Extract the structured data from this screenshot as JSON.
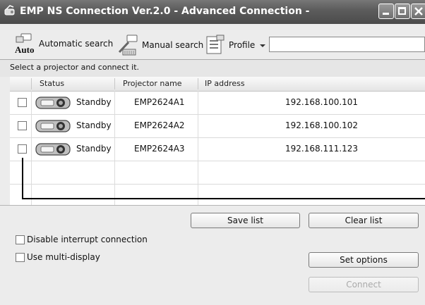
{
  "window": {
    "title": "EMP NS Connection Ver.2.0 - Advanced Connection -"
  },
  "toolbar": {
    "auto_badge": "Auto",
    "automatic_search": "Automatic search",
    "manual_search": "Manual search",
    "profile": "Profile",
    "profile_value": ""
  },
  "instruction": "Select a projector and connect it.",
  "list": {
    "columns": [
      "Status",
      "Projector name",
      "IP address"
    ],
    "rows": [
      {
        "checked": false,
        "status": "Standby",
        "name": "EMP2624A1",
        "ip": "192.168.100.101"
      },
      {
        "checked": false,
        "status": "Standby",
        "name": "EMP2624A2",
        "ip": "192.168.100.102"
      },
      {
        "checked": false,
        "status": "Standby",
        "name": "EMP2624A3",
        "ip": "192.168.111.123"
      }
    ]
  },
  "buttons": {
    "save_list": "Save list",
    "clear_list": "Clear list",
    "set_options": "Set options",
    "connect": "Connect"
  },
  "options": {
    "disable_interrupt": "Disable interrupt connection",
    "use_multi_display": "Use multi-display"
  },
  "colors": {
    "titlebar": "#5d5d5d",
    "accent": "#ffffff"
  }
}
